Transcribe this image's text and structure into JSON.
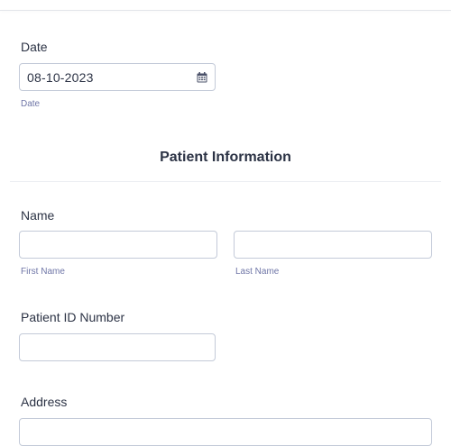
{
  "date_field": {
    "label": "Date",
    "value": "08-10-2023",
    "sublabel": "Date",
    "icon": "calendar-icon"
  },
  "section": {
    "title": "Patient Information"
  },
  "name_field": {
    "label": "Name",
    "first_sublabel": "First Name",
    "last_sublabel": "Last Name",
    "first_value": "",
    "last_value": ""
  },
  "patient_id_field": {
    "label": "Patient ID Number",
    "value": ""
  },
  "address_field": {
    "label": "Address",
    "value": ""
  },
  "colors": {
    "text": "#2c3345",
    "sublabel": "#6f76a7",
    "border": "#c3cad8"
  }
}
